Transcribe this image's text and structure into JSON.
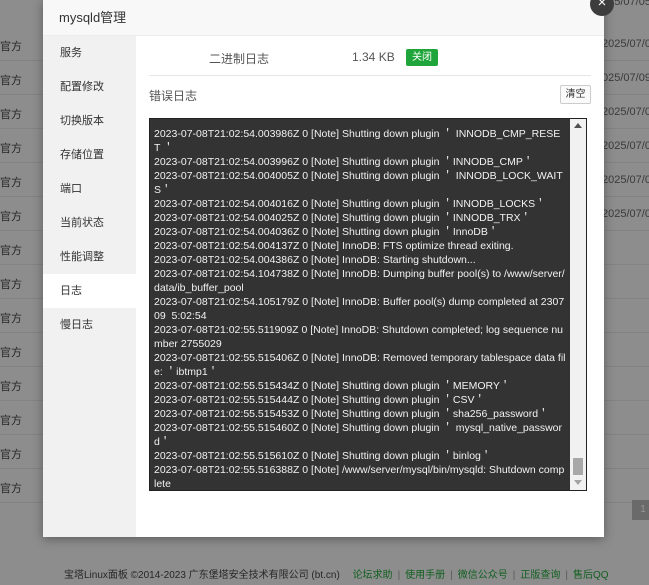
{
  "background": {
    "left_labels": [
      "官方",
      "官方",
      "官方",
      "官方",
      "官方",
      "官方",
      "官方",
      "官方",
      "官方",
      "官方",
      "官方",
      "官方",
      "官方",
      "官方"
    ],
    "right_labels": [
      "025/07/05",
      "2025/07/0",
      "025/07/09",
      "2025/07/0",
      "2025/07/09",
      "2025/07/0",
      "2025/07/0"
    ],
    "page_button": "1",
    "footer": {
      "copyright": "宝塔Linux面板 ©2014-2023 广东堡塔安全技术有限公司 (bt.cn)",
      "links": [
        "论坛求助",
        "使用手册",
        "微信公众号",
        "正版查询",
        "售后QQ"
      ]
    }
  },
  "modal": {
    "title": "mysqld管理",
    "close_glyph": "×",
    "sidebar": [
      "服务",
      "配置修改",
      "切换版本",
      "存储位置",
      "端口",
      "当前状态",
      "性能调整",
      "日志",
      "慢日志"
    ],
    "active_index": 7,
    "binlog": {
      "label": "二进制日志",
      "size": "1.34 KB",
      "status": "关闭"
    },
    "errlog": {
      "title": "错误日志",
      "clear_label": "清空",
      "lines": [
        "2023-07-08T21:02:54.003986Z 0 [Note] Shutting down plugin ＇ INNODB_CMP_RESET ＇",
        "2023-07-08T21:02:54.003996Z 0 [Note] Shutting down plugin ＇INNODB_CMP＇",
        "2023-07-08T21:02:54.004005Z 0 [Note] Shutting down plugin ＇ INNODB_LOCK_WAITS＇",
        "2023-07-08T21:02:54.004016Z 0 [Note] Shutting down plugin ＇INNODB_LOCKS＇",
        "2023-07-08T21:02:54.004025Z 0 [Note] Shutting down plugin ＇INNODB_TRX＇",
        "2023-07-08T21:02:54.004036Z 0 [Note] Shutting down plugin ＇InnoDB＇",
        "2023-07-08T21:02:54.004137Z 0 [Note] InnoDB: FTS optimize thread exiting.",
        "2023-07-08T21:02:54.004386Z 0 [Note] InnoDB: Starting shutdown...",
        "2023-07-08T21:02:54.104738Z 0 [Note] InnoDB: Dumping buffer pool(s) to /www/server/data/ib_buffer_pool",
        "2023-07-08T21:02:54.105179Z 0 [Note] InnoDB: Buffer pool(s) dump completed at 230709  5:02:54",
        "2023-07-08T21:02:55.511909Z 0 [Note] InnoDB: Shutdown completed; log sequence number 2755029",
        "2023-07-08T21:02:55.515406Z 0 [Note] InnoDB: Removed temporary tablespace data file: ＇ibtmp1＇",
        "2023-07-08T21:02:55.515434Z 0 [Note] Shutting down plugin ＇MEMORY＇",
        "2023-07-08T21:02:55.515444Z 0 [Note] Shutting down plugin ＇CSV＇",
        "2023-07-08T21:02:55.515453Z 0 [Note] Shutting down plugin ＇sha256_password＇",
        "2023-07-08T21:02:55.515460Z 0 [Note] Shutting down plugin ＇ mysql_native_password＇",
        "2023-07-08T21:02:55.515610Z 0 [Note] Shutting down plugin ＇binlog＇",
        "2023-07-08T21:02:55.516388Z 0 [Note] /www/server/mysql/bin/mysqld: Shutdown complete"
      ]
    }
  },
  "colors": {
    "accent": "#20a53a",
    "log_bg": "#333333"
  }
}
